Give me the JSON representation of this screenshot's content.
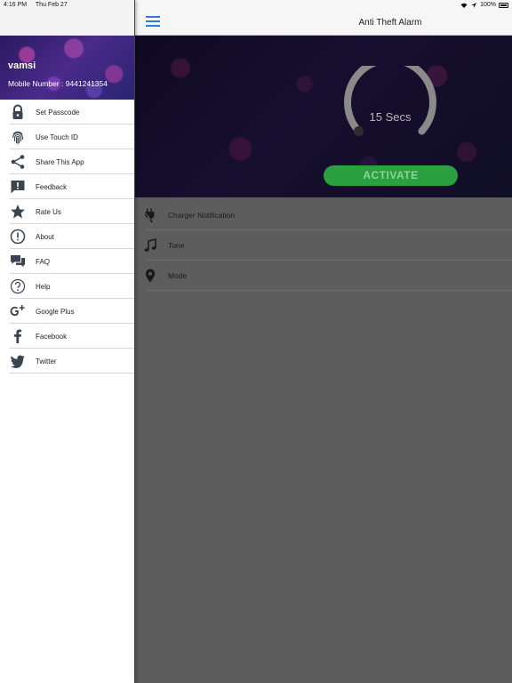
{
  "status": {
    "time": "4:16 PM",
    "date": "Thu Feb 27",
    "battery": "100%"
  },
  "profile": {
    "name": "vamsi",
    "mobile": "Mobile Number : 9441241354"
  },
  "menu": [
    {
      "label": "Set Passcode",
      "icon": "lock-icon"
    },
    {
      "label": "Use Touch ID",
      "icon": "fingerprint-icon"
    },
    {
      "label": "Share This App",
      "icon": "share-icon"
    },
    {
      "label": "Feedback",
      "icon": "feedback-icon"
    },
    {
      "label": "Rate Us",
      "icon": "star-icon"
    },
    {
      "label": "About",
      "icon": "info-icon"
    },
    {
      "label": "FAQ",
      "icon": "chat-icon"
    },
    {
      "label": "Help",
      "icon": "help-icon"
    },
    {
      "label": "Google Plus",
      "icon": "google-plus-icon"
    },
    {
      "label": "Facebook",
      "icon": "facebook-icon"
    },
    {
      "label": "Twitter",
      "icon": "twitter-icon"
    }
  ],
  "navbar": {
    "title": "Anti Theft Alarm"
  },
  "timer": {
    "label": "15 Secs"
  },
  "activate_label": "ACTIVATE",
  "options": [
    {
      "label": "Charger Notification",
      "icon": "plug-icon"
    },
    {
      "label": "Tone",
      "icon": "music-note-icon"
    },
    {
      "label": "Mode",
      "icon": "location-pin-icon"
    }
  ],
  "colors": {
    "accent": "#2a7fd4",
    "activate": "#2aa040",
    "icon": "#3a4550"
  }
}
